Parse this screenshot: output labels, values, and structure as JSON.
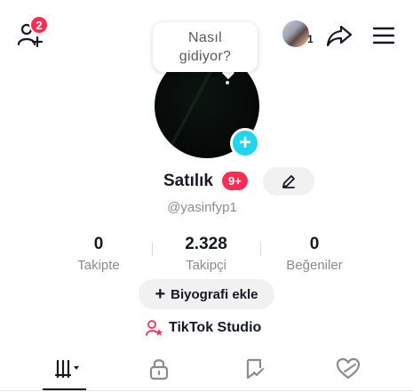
{
  "top_bar": {
    "notification_count": "2",
    "account_count": "1"
  },
  "bubble": {
    "line1": "Nasıl",
    "line2": "gidiyor?"
  },
  "profile": {
    "username": "Satılık",
    "badge": "9+",
    "handle": "@yasinfyp1"
  },
  "stats": {
    "following": {
      "value": "0",
      "label": "Takipte"
    },
    "followers": {
      "value": "2.328",
      "label": "Takipçi"
    },
    "likes": {
      "value": "0",
      "label": "Beğeniler"
    }
  },
  "actions": {
    "bio_label": "Biyografi ekle",
    "studio_label": "TikTok Studio"
  },
  "tabs": [
    {
      "name": "videos",
      "icon": "grid-icon",
      "active": true
    },
    {
      "name": "private",
      "icon": "lock-icon",
      "active": false
    },
    {
      "name": "reposts",
      "icon": "repost-icon",
      "active": false
    },
    {
      "name": "liked",
      "icon": "heart-icon",
      "active": false
    }
  ],
  "colors": {
    "accent": "#fe2c55",
    "add_photo": "#20d5ec"
  }
}
